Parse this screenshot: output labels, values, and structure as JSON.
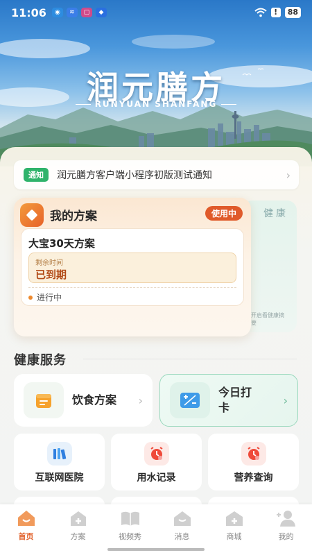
{
  "status_bar": {
    "time": "11:06",
    "battery": "88",
    "alert": "!"
  },
  "hero": {
    "title": "润元膳方",
    "subtitle": "RUNYUAN SHANFANG"
  },
  "notice": {
    "tag": "通知",
    "text": "润元膳方客户端小程序初版测试通知"
  },
  "plan_card": {
    "title": "我的方案",
    "badge": "使用中",
    "plan_name": "大宝30天方案",
    "remaining_label": "剩余时间",
    "remaining_value": "已到期",
    "status": "进行中"
  },
  "health_card": {
    "title": "健康",
    "desc": "开启看健康摘要"
  },
  "health_services": {
    "title": "健康服务",
    "primary": [
      {
        "label": "饮食方案",
        "icon": "notepad-icon"
      },
      {
        "label": "今日打\n卡",
        "icon": "plus-minus-icon"
      }
    ],
    "secondary": [
      {
        "label": "互联网医院",
        "icon": "books-icon"
      },
      {
        "label": "用水记录",
        "icon": "alarm-clock-icon"
      },
      {
        "label": "营养查询",
        "icon": "alarm-clock-icon"
      }
    ]
  },
  "tab_bar": [
    {
      "label": "首页",
      "icon": "home-icon",
      "active": true
    },
    {
      "label": "方案",
      "icon": "plan-icon",
      "active": false
    },
    {
      "label": "视频秀",
      "icon": "video-book-icon",
      "active": false
    },
    {
      "label": "消息",
      "icon": "message-icon",
      "active": false
    },
    {
      "label": "商城",
      "icon": "mall-icon",
      "active": false
    },
    {
      "label": "我的",
      "icon": "profile-icon",
      "active": false
    }
  ],
  "colors": {
    "accent": "#e2632d",
    "notice_tag": "#2fb36b",
    "badge": "#e05a2a"
  }
}
